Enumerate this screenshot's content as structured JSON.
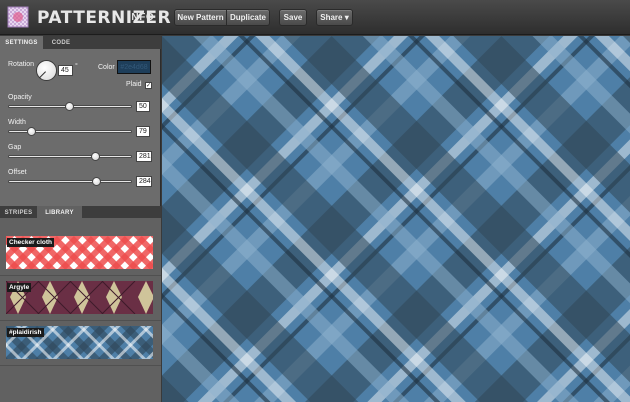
{
  "header": {
    "brand": "PATTERNIZER",
    "info": "INFO",
    "new_pattern": "New Pattern",
    "duplicate": "Duplicate",
    "save": "Save",
    "share": "Share ▾"
  },
  "settings": {
    "tabs": [
      "SETTINGS",
      "CODE"
    ],
    "rotation_label": "Rotation",
    "rotation_value": "45",
    "degree": "°",
    "color_label": "Color",
    "color_value": "#2e4d68",
    "plaid_label": "Plaid",
    "plaid_checked": "✓",
    "sliders": [
      {
        "label": "Opacity",
        "value": "50",
        "fraction": 0.5
      },
      {
        "label": "Width",
        "value": "79",
        "fraction": 0.19
      },
      {
        "label": "Gap",
        "value": "281",
        "fraction": 0.71
      },
      {
        "label": "Offset",
        "value": "284",
        "fraction": 0.72
      }
    ]
  },
  "library": {
    "tabs": [
      "STRIPES",
      "LIBRARY"
    ],
    "items": [
      {
        "name": "Checker cloth"
      },
      {
        "name": "Argyle"
      },
      {
        "name": "#plaidirish"
      }
    ]
  },
  "colors": {
    "canvas_base": "#4e7fa7",
    "stripe_dark": "#2f4658",
    "stripe_light": "#ffffff"
  }
}
